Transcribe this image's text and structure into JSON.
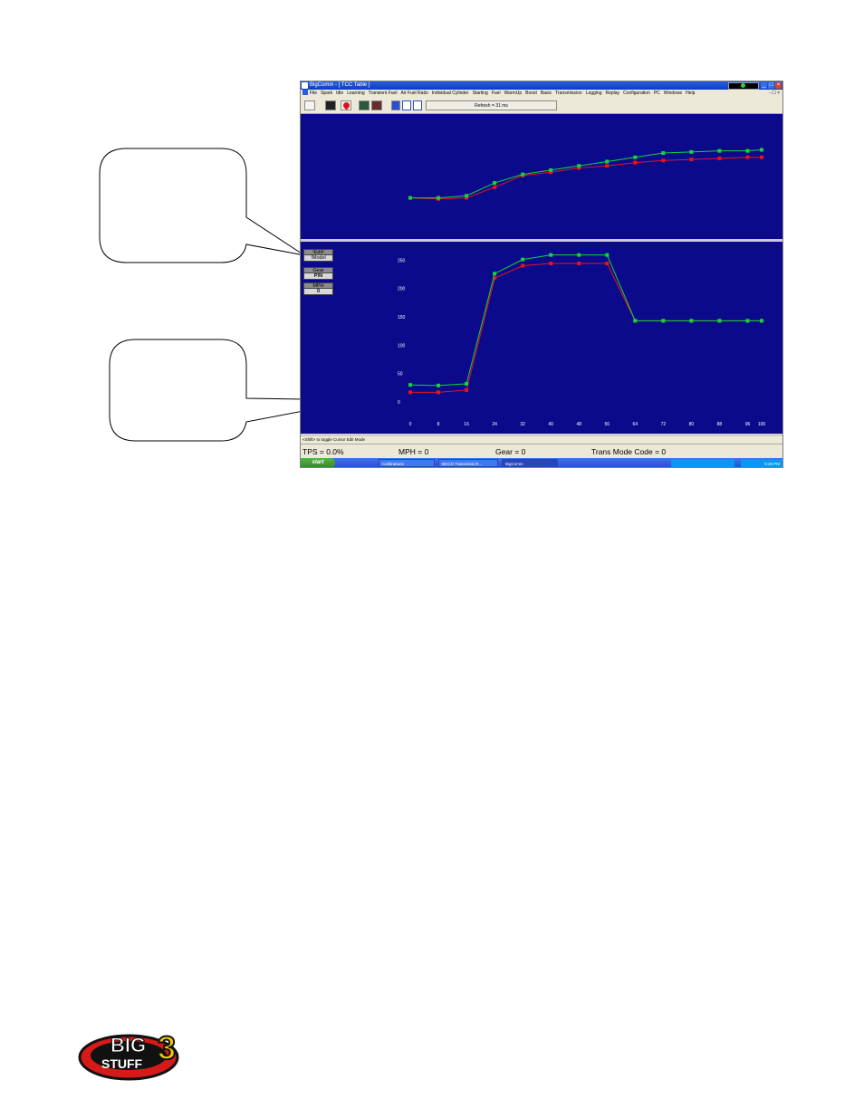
{
  "window": {
    "title": "BigComm - [ TCC Table ]",
    "controls": [
      "_",
      "□",
      "×"
    ]
  },
  "menu": {
    "items": [
      "File",
      "Spark",
      "Idle",
      "Learning",
      "Transient Fuel",
      "Air Fuel Ratio",
      "Individual Cylinder",
      "Starting",
      "Fuel",
      "WarmUp",
      "Boost",
      "Basic",
      "Transmission",
      "Logging",
      "Replay",
      "Configuration",
      "PC",
      "Windows",
      "Help"
    ],
    "right_controls": "- ☐ ×"
  },
  "toolbar": {
    "refresh_label": "Refresh = 31 ms"
  },
  "side_panel": {
    "edit_label": "!Edit!",
    "model_label": "!Model",
    "gear_label": "Gear",
    "gear_value": "P/N",
    "mph_label": "MPH",
    "mph_value": "0"
  },
  "hint": "<Shift> to toggle Cursor Edit Mode",
  "status": {
    "tps": "TPS = 0.0%",
    "mph": "MPH = 0",
    "gear": "Gear = 0",
    "mode": "Trans Mode Code = 0"
  },
  "taskbar": {
    "start": "start",
    "tasks": [
      "Calibrations",
      "BGCO Transmissi R...",
      "BigComm"
    ],
    "clock": "5:26 PM"
  },
  "colors": {
    "panel": "#0a0a8a",
    "series_green": "#17d33b",
    "series_red": "#e8141a"
  },
  "chart_data": [
    {
      "type": "line",
      "x": [
        0,
        8,
        16,
        24,
        32,
        40,
        48,
        56,
        64,
        72,
        80,
        88,
        96,
        100
      ],
      "series": [
        {
          "values": [
            30,
            30,
            32,
            44,
            52,
            56,
            60,
            64,
            68,
            72,
            73,
            74,
            74,
            75
          ]
        },
        {
          "values": [
            30,
            29,
            30,
            40,
            51,
            54,
            58,
            60,
            63,
            65,
            66,
            67,
            68,
            68
          ]
        }
      ],
      "ylim": [
        0,
        100
      ],
      "xlim": [
        0,
        100
      ]
    },
    {
      "type": "line",
      "x": [
        0,
        8,
        16,
        24,
        32,
        40,
        48,
        56,
        64,
        72,
        80,
        88,
        96,
        100
      ],
      "x_tick_labels": [
        "0",
        "8",
        "16",
        "24",
        "32",
        "40",
        "48",
        "56",
        "64",
        "72",
        "80",
        "88",
        "96",
        "100"
      ],
      "y_ticks": [
        0,
        50,
        100,
        150,
        200,
        250
      ],
      "ylim": [
        0,
        260
      ],
      "xlim": [
        0,
        100
      ],
      "series": [
        {
          "values": [
            30,
            29,
            32,
            226,
            251,
            259,
            259,
            259,
            143,
            143,
            143,
            143,
            143,
            143
          ]
        },
        {
          "values": [
            17,
            17,
            21,
            218,
            240,
            244,
            244,
            244,
            143,
            143,
            143,
            143,
            143,
            143
          ]
        }
      ]
    }
  ]
}
